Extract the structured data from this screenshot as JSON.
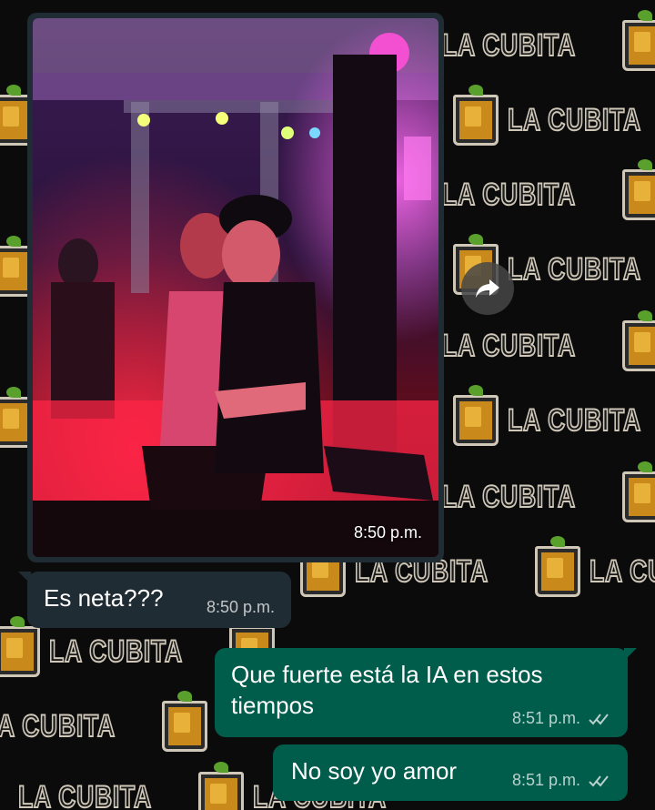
{
  "wallpaper": {
    "brand_text": "LA CUBITA"
  },
  "image_message": {
    "time": "8:50 p.m."
  },
  "messages": [
    {
      "direction": "incoming",
      "text": "Es neta???",
      "time": "8:50 p.m."
    },
    {
      "direction": "outgoing",
      "text": "Que fuerte está la IA en estos tiempos",
      "time": "8:51 p.m.",
      "status_icon": "double-check-icon"
    },
    {
      "direction": "outgoing",
      "text": "No soy yo amor",
      "time": "8:51 p.m.",
      "status_icon": "double-check-icon"
    }
  ],
  "icons": {
    "forward": "forward-arrow-icon"
  },
  "colors": {
    "incoming_bubble": "#202c33",
    "outgoing_bubble": "#005c4b",
    "background": "#0b0b0b"
  }
}
